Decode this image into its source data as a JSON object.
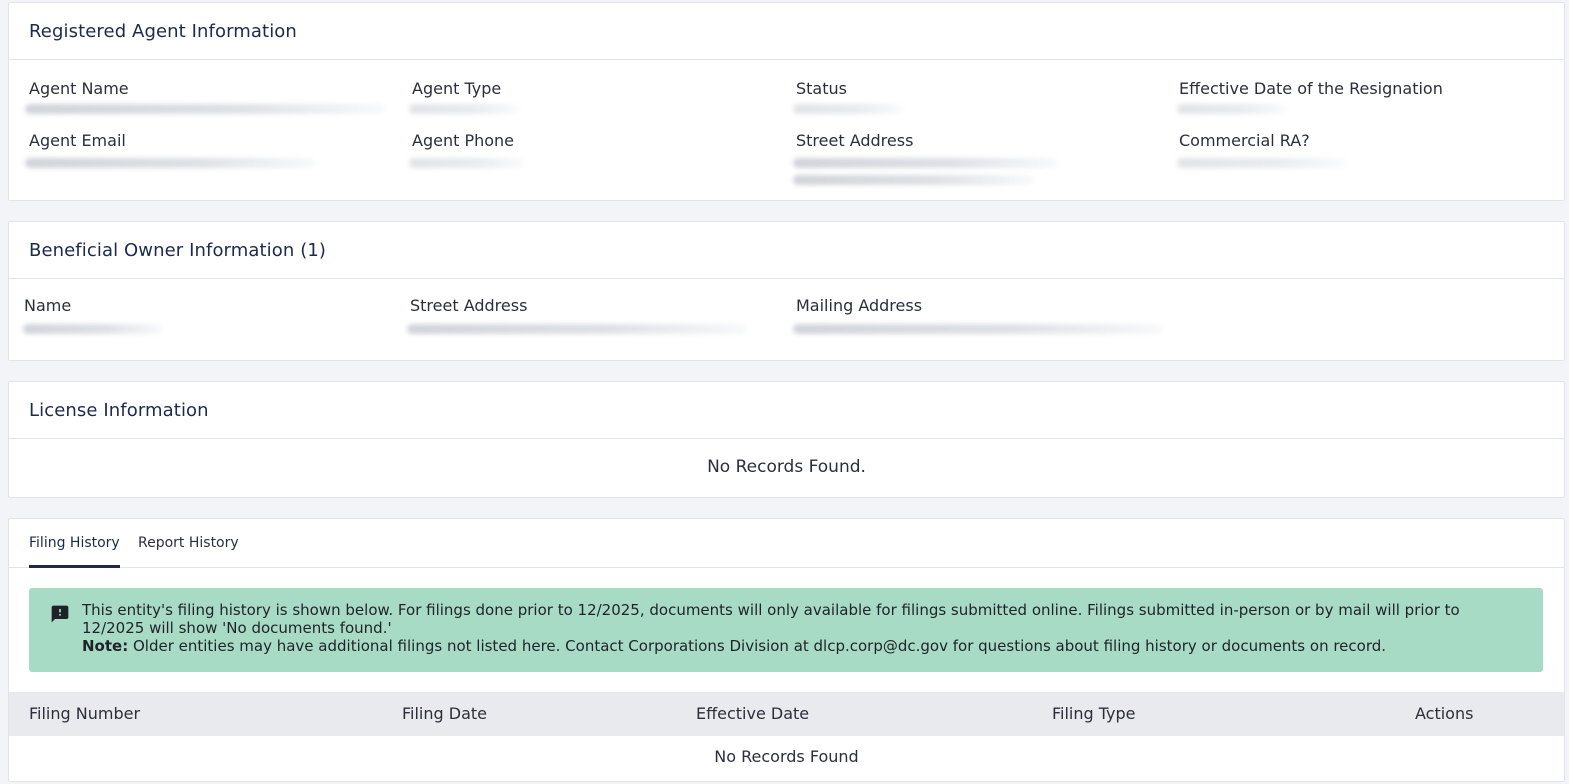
{
  "registered_agent": {
    "title": "Registered Agent Information",
    "fields": {
      "agent_name": "Agent Name",
      "agent_type": "Agent Type",
      "status": "Status",
      "effective_date": "Effective Date of the Resignation",
      "agent_email": "Agent Email",
      "agent_phone": "Agent Phone",
      "street_address": "Street Address",
      "commercial_ra": "Commercial RA?"
    }
  },
  "beneficial_owner": {
    "title": "Beneficial Owner Information (1)",
    "fields": {
      "name": "Name",
      "street_address": "Street Address",
      "mailing_address": "Mailing Address"
    }
  },
  "license": {
    "title": "License Information",
    "empty_message": "No Records Found."
  },
  "history": {
    "tabs": [
      {
        "label": "Filing History",
        "active": true
      },
      {
        "label": "Report History",
        "active": false
      }
    ],
    "notice": {
      "icon": "feedback-icon",
      "text": "This entity's filing history is shown below. For filings done prior to 12/2025, documents will only available for filings submitted online. Filings submitted in-person or by mail will prior to 12/2025 will show 'No documents found.'",
      "note_label": "Note:",
      "note_text": " Older entities may have additional filings not listed here. Contact Corporations Division at dlcp.corp@dc.gov for questions about filing history or documents on record."
    },
    "table": {
      "columns": [
        "Filing Number",
        "Filing Date",
        "Effective Date",
        "Filing Type",
        "Actions"
      ],
      "empty_message": "No Records Found"
    }
  },
  "colors": {
    "page_bg": "#f3f4f7",
    "card_bg": "#ffffff",
    "title": "#1d2a4d",
    "notice_bg": "#a8dbc6",
    "table_head_bg": "#e9eaed"
  }
}
